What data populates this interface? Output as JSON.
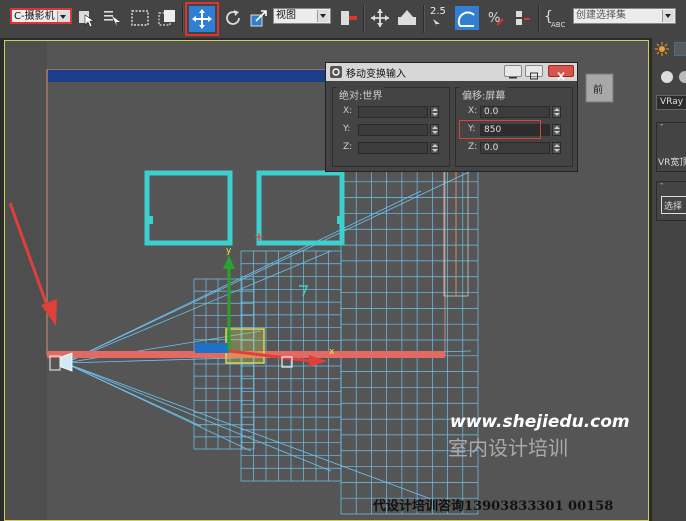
{
  "toolbar": {
    "camera_select": "C-摄影机",
    "coord_select": "视图",
    "snap_value": "2.5",
    "selection_set_placeholder": "创建选择集"
  },
  "viewport": {
    "label": "]",
    "viewcube_label": "前",
    "axis_y": "y",
    "axis_x": "x"
  },
  "dialog": {
    "title": "移动变换输入",
    "absolute_group": "绝对:世界",
    "offset_group": "偏移:屏幕",
    "absolute": {
      "x": "",
      "y": "",
      "z": ""
    },
    "offset": {
      "x": "0.0",
      "y": "850",
      "z": "0.0"
    },
    "labels": {
      "x": "X:",
      "y": "Y:",
      "z": "Z:"
    }
  },
  "right_panel": {
    "renderer": "VRay",
    "vr_label": "VR宽顶",
    "select_label": "选择"
  },
  "watermark": {
    "url": "www.shejiedu.com",
    "cn": "室内设计培训",
    "contact": "代设计培训咨询13903833301  00158"
  },
  "colors": {
    "accent_red": "#e0403a",
    "cyan": "#3ecfcf",
    "wire_blue": "#6fc3ef",
    "highlight_blue": "#2f7fd3",
    "viewport_bg": "#555555"
  }
}
